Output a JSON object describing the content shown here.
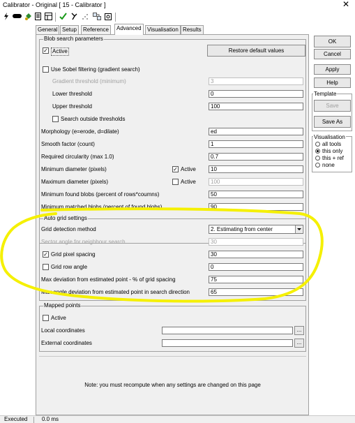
{
  "window": {
    "title": "Calibrator - Original [ 15 - Calibrator ]",
    "close": "✕"
  },
  "toolbar": {
    "icons": [
      "lightning-icon",
      "ruler-icon",
      "paint-bucket-icon",
      "document-icon",
      "grid-icon",
      "checkmark-icon",
      "scale-icon",
      "dots-icon",
      "pipeline-icon",
      "clipboard-icon"
    ]
  },
  "tabs": [
    "General",
    "Setup",
    "Reference",
    "Advanced",
    "Visualisation",
    "Results"
  ],
  "active_tab": "Advanced",
  "blob": {
    "title": "Blob search parameters",
    "active_label": "Active",
    "restore_label": "Restore default values",
    "sobel_label": "Use Sobel filtering (gradient search)",
    "grad_threshold_label": "Gradient threshold (minimum)",
    "grad_threshold_value": "3",
    "lower_label": "Lower threshold",
    "lower_value": "0",
    "upper_label": "Upper threshold",
    "upper_value": "100",
    "outside_label": "Search outside thresholds",
    "morph_label": "Morphology (e=erode, d=dilate)",
    "morph_value": "ed",
    "smooth_label": "Smooth factor (count)",
    "smooth_value": "1",
    "circ_label": "Required circularity (max 1.0)",
    "circ_value": "0.7",
    "mindiam_label": "Minimum diameter (pixels)",
    "mindiam_active": "Active",
    "mindiam_value": "10",
    "maxdiam_label": "Maximum diameter (pixels)",
    "maxdiam_active": "Active",
    "maxdiam_value": "100",
    "minfound_label": "Minimum found blobs (percent of rows*coumns)",
    "minfound_value": "50",
    "minmatched_label": "Minimum matched blobs (percent of found blobs)",
    "minmatched_value": "90"
  },
  "grid": {
    "title": "Auto grid settings",
    "method_label": "Grid detection method",
    "method_value": "2. Estimating from center",
    "sector_label": "Sector angle for neighbour search",
    "sector_value": "30",
    "spacing_label": "Grid pixel spacing",
    "spacing_value": "30",
    "rowangle_label": "Grid row angle",
    "rowangle_value": "0",
    "maxdev_label": "Max deviation from estimated point - % of grid spacing",
    "maxdev_value": "75",
    "maxangle_label": "Max angle deviation from estimated point in search direction",
    "maxangle_value": "65"
  },
  "mapped": {
    "title": "Mapped points",
    "active_label": "Active",
    "local_label": "Local coordinates",
    "local_value": "",
    "external_label": "External coordinates",
    "external_value": "",
    "browse": "..."
  },
  "note": "Note: you must recompute when any settings are changed on this page",
  "right": {
    "ok": "OK",
    "cancel": "Cancel",
    "apply": "Apply",
    "help": "Help",
    "template_title": "Template",
    "save": "Save",
    "save_as": "Save As",
    "vis_title": "Visualisation",
    "vis_options": [
      "all tools",
      "this only",
      "this + ref",
      "none"
    ],
    "vis_selected": 1
  },
  "status": {
    "state": "Executed",
    "time": "0.0 ms"
  },
  "colors": {
    "highlight": "#f5f000",
    "panel": "#f0f0f0",
    "border": "#a0a0a0"
  }
}
